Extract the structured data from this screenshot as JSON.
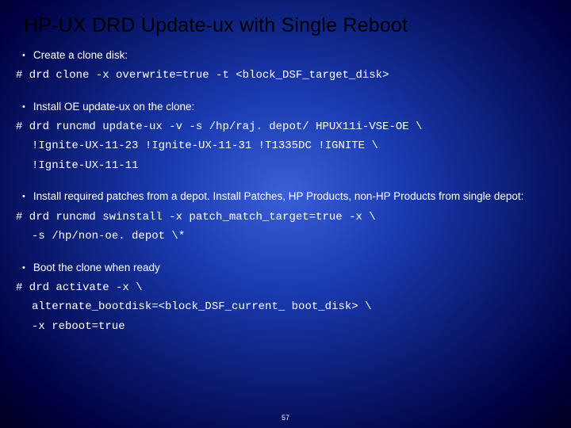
{
  "title": "HP-UX DRD Update-ux with Single Reboot",
  "sections": [
    {
      "bullet": "Create a clone disk:",
      "cmd": [
        "# drd clone -x overwrite=true -t <block_DSF_target_disk>"
      ]
    },
    {
      "bullet": "Install OE update-ux on the clone:",
      "cmd": [
        "# drd runcmd update-ux -v -s /hp/raj. depot/ HPUX11i-VSE-OE \\",
        "  !Ignite-UX-11-23 !Ignite-UX-11-31 !T1335DC !IGNITE \\",
        "  !Ignite-UX-11-11"
      ]
    },
    {
      "bullet": "Install required patches from a depot. Install Patches, HP Products, non-HP Products from single depot:",
      "cmd": [
        "# drd runcmd swinstall -x patch_match_target=true -x \\",
        "  -s /hp/non-oe. depot \\*"
      ]
    },
    {
      "bullet": "Boot the clone when ready",
      "cmd": [
        "# drd activate -x \\",
        "  alternate_bootdisk=<block_DSF_current_ boot_disk> \\",
        "  -x reboot=true"
      ]
    }
  ],
  "pageNumber": "57"
}
